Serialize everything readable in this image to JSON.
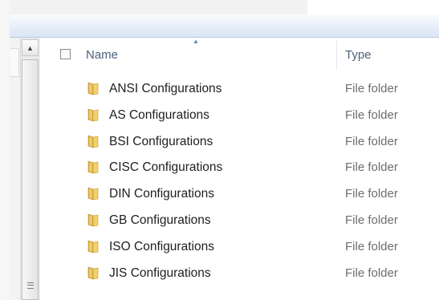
{
  "columns": {
    "name": "Name",
    "type": "Type"
  },
  "files": [
    {
      "name": "ANSI Configurations",
      "type": "File folder",
      "icon": "folder-icon"
    },
    {
      "name": "AS Configurations",
      "type": "File folder",
      "icon": "folder-icon"
    },
    {
      "name": "BSI Configurations",
      "type": "File folder",
      "icon": "folder-icon"
    },
    {
      "name": "CISC Configurations",
      "type": "File folder",
      "icon": "folder-icon"
    },
    {
      "name": "DIN Configurations",
      "type": "File folder",
      "icon": "folder-icon"
    },
    {
      "name": "GB Configurations",
      "type": "File folder",
      "icon": "folder-icon"
    },
    {
      "name": "ISO Configurations",
      "type": "File folder",
      "icon": "folder-icon"
    },
    {
      "name": "JIS Configurations",
      "type": "File folder",
      "icon": "folder-icon"
    }
  ],
  "colors": {
    "header_text": "#4c607a",
    "folder": "#e8c04a",
    "type_text": "#6d6d6d"
  }
}
